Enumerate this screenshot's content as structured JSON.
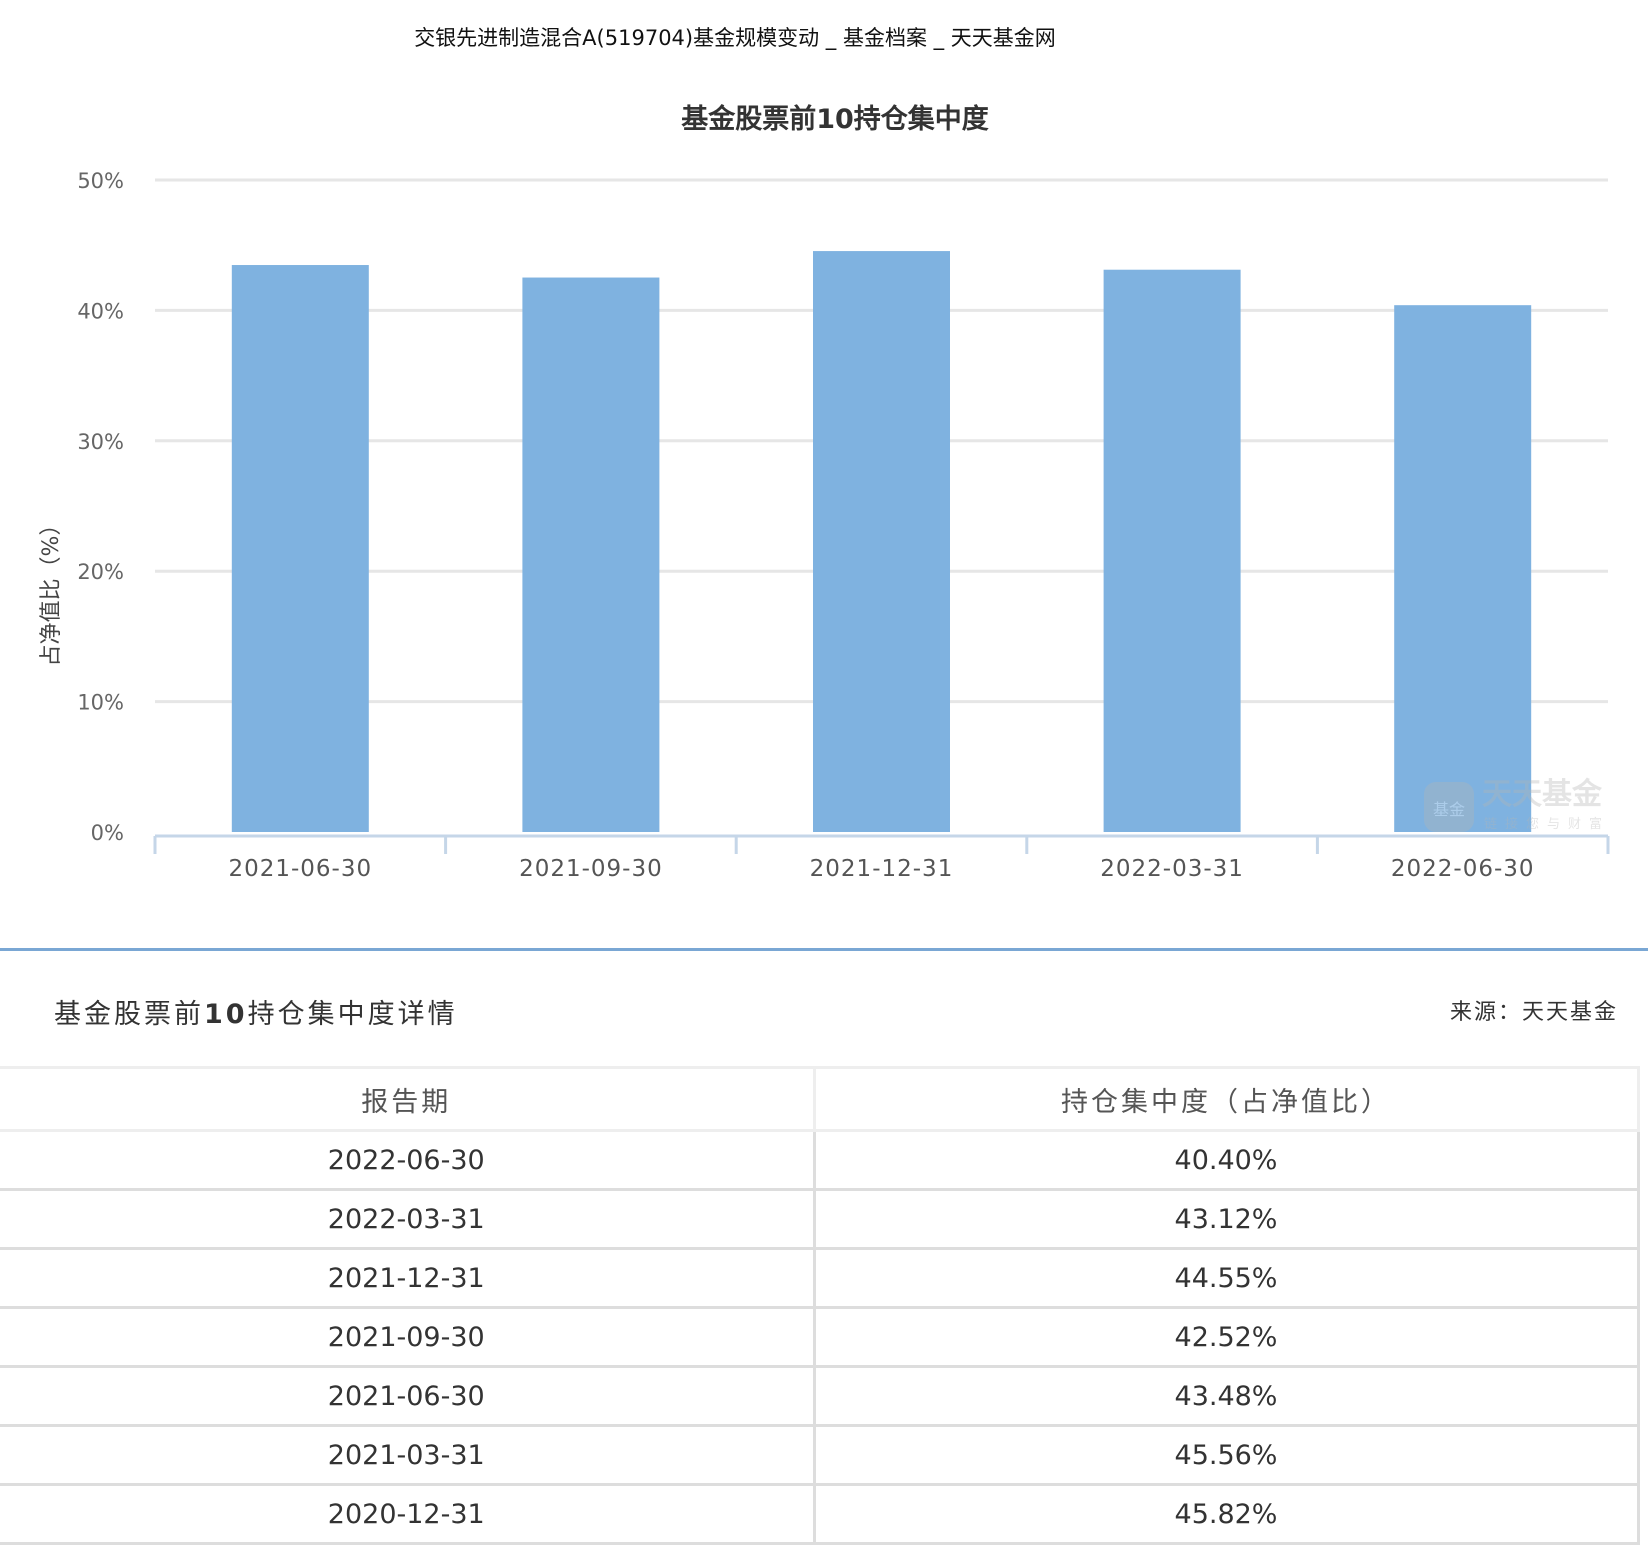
{
  "page": {
    "title": "交银先进制造混合A(519704)基金规模变动 _ 基金档案 _ 天天基金网"
  },
  "chart_data": {
    "type": "bar",
    "title": "基金股票前10持仓集中度",
    "ylabel": "占净值比（%）",
    "xlabel": "",
    "categories": [
      "2021-06-30",
      "2021-09-30",
      "2021-12-31",
      "2022-03-31",
      "2022-06-30"
    ],
    "values": [
      43.48,
      42.52,
      44.55,
      43.12,
      40.4
    ],
    "ylim": [
      0,
      50
    ],
    "yticks": [
      "0%",
      "10%",
      "20%",
      "30%",
      "40%",
      "50%"
    ],
    "grid": true,
    "bar_color": "#7fb2e0",
    "watermark": {
      "brand": "天天基金",
      "badge": "基金",
      "slogan": "链接您与财富"
    }
  },
  "details": {
    "title_prefix": "基金股票前",
    "title_number": "10",
    "title_suffix": "持仓集中度详情",
    "source": "来源：天天基金",
    "columns": [
      "报告期",
      "持仓集中度（占净值比）"
    ],
    "rows": [
      [
        "2022-06-30",
        "40.40%"
      ],
      [
        "2022-03-31",
        "43.12%"
      ],
      [
        "2021-12-31",
        "44.55%"
      ],
      [
        "2021-09-30",
        "42.52%"
      ],
      [
        "2021-06-30",
        "43.48%"
      ],
      [
        "2021-03-31",
        "45.56%"
      ],
      [
        "2020-12-31",
        "45.82%"
      ]
    ]
  }
}
